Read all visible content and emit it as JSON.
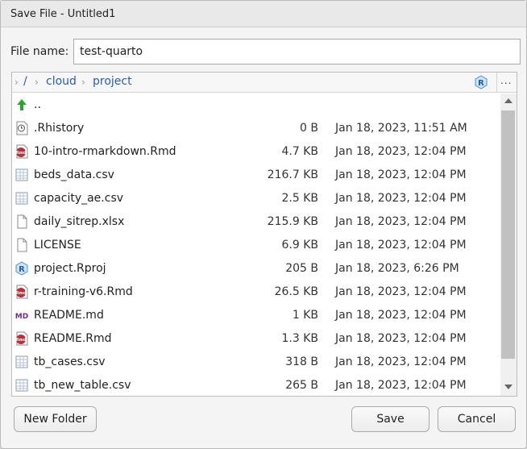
{
  "dialog": {
    "title": "Save File - Untitled1",
    "filename_label": "File name:",
    "filename_value": "test-quarto"
  },
  "path": {
    "crumbs": [
      "/",
      "cloud",
      "project"
    ],
    "more_label": "..."
  },
  "files": [
    {
      "name": "..",
      "size": "",
      "modified": "",
      "icon": "parent-folder-icon"
    },
    {
      "name": ".Rhistory",
      "size": "0 B",
      "modified": "Jan 18, 2023, 11:51 AM",
      "icon": "history-icon"
    },
    {
      "name": "10-intro-rmarkdown.Rmd",
      "size": "4.7 KB",
      "modified": "Jan 18, 2023, 12:04 PM",
      "icon": "rmd-icon"
    },
    {
      "name": "beds_data.csv",
      "size": "216.7 KB",
      "modified": "Jan 18, 2023, 12:04 PM",
      "icon": "csv-icon"
    },
    {
      "name": "capacity_ae.csv",
      "size": "2.5 KB",
      "modified": "Jan 18, 2023, 12:04 PM",
      "icon": "csv-icon"
    },
    {
      "name": "daily_sitrep.xlsx",
      "size": "215.9 KB",
      "modified": "Jan 18, 2023, 12:04 PM",
      "icon": "file-icon"
    },
    {
      "name": "LICENSE",
      "size": "6.9 KB",
      "modified": "Jan 18, 2023, 12:04 PM",
      "icon": "file-icon"
    },
    {
      "name": "project.Rproj",
      "size": "205 B",
      "modified": "Jan 18, 2023, 6:26 PM",
      "icon": "rproj-icon"
    },
    {
      "name": "r-training-v6.Rmd",
      "size": "26.5 KB",
      "modified": "Jan 18, 2023, 12:04 PM",
      "icon": "rmd-icon"
    },
    {
      "name": "README.md",
      "size": "1 KB",
      "modified": "Jan 18, 2023, 12:04 PM",
      "icon": "markdown-icon"
    },
    {
      "name": "README.Rmd",
      "size": "1.3 KB",
      "modified": "Jan 18, 2023, 12:04 PM",
      "icon": "rmd-icon"
    },
    {
      "name": "tb_cases.csv",
      "size": "318 B",
      "modified": "Jan 18, 2023, 12:04 PM",
      "icon": "csv-icon"
    },
    {
      "name": "tb_new_table.csv",
      "size": "265 B",
      "modified": "Jan 18, 2023, 12:04 PM",
      "icon": "csv-icon"
    }
  ],
  "icon_labels": {
    "rmd": "Rmd",
    "markdown": "MD",
    "rproj": "R"
  },
  "buttons": {
    "new_folder": "New Folder",
    "save": "Save",
    "cancel": "Cancel"
  },
  "colors": {
    "link": "#2a5db0",
    "parent_arrow": "#2fa32f",
    "rmd_badge": "#b8303a",
    "rproj_blue": "#4b8fd1",
    "markdown_purple": "#6f2c91"
  }
}
